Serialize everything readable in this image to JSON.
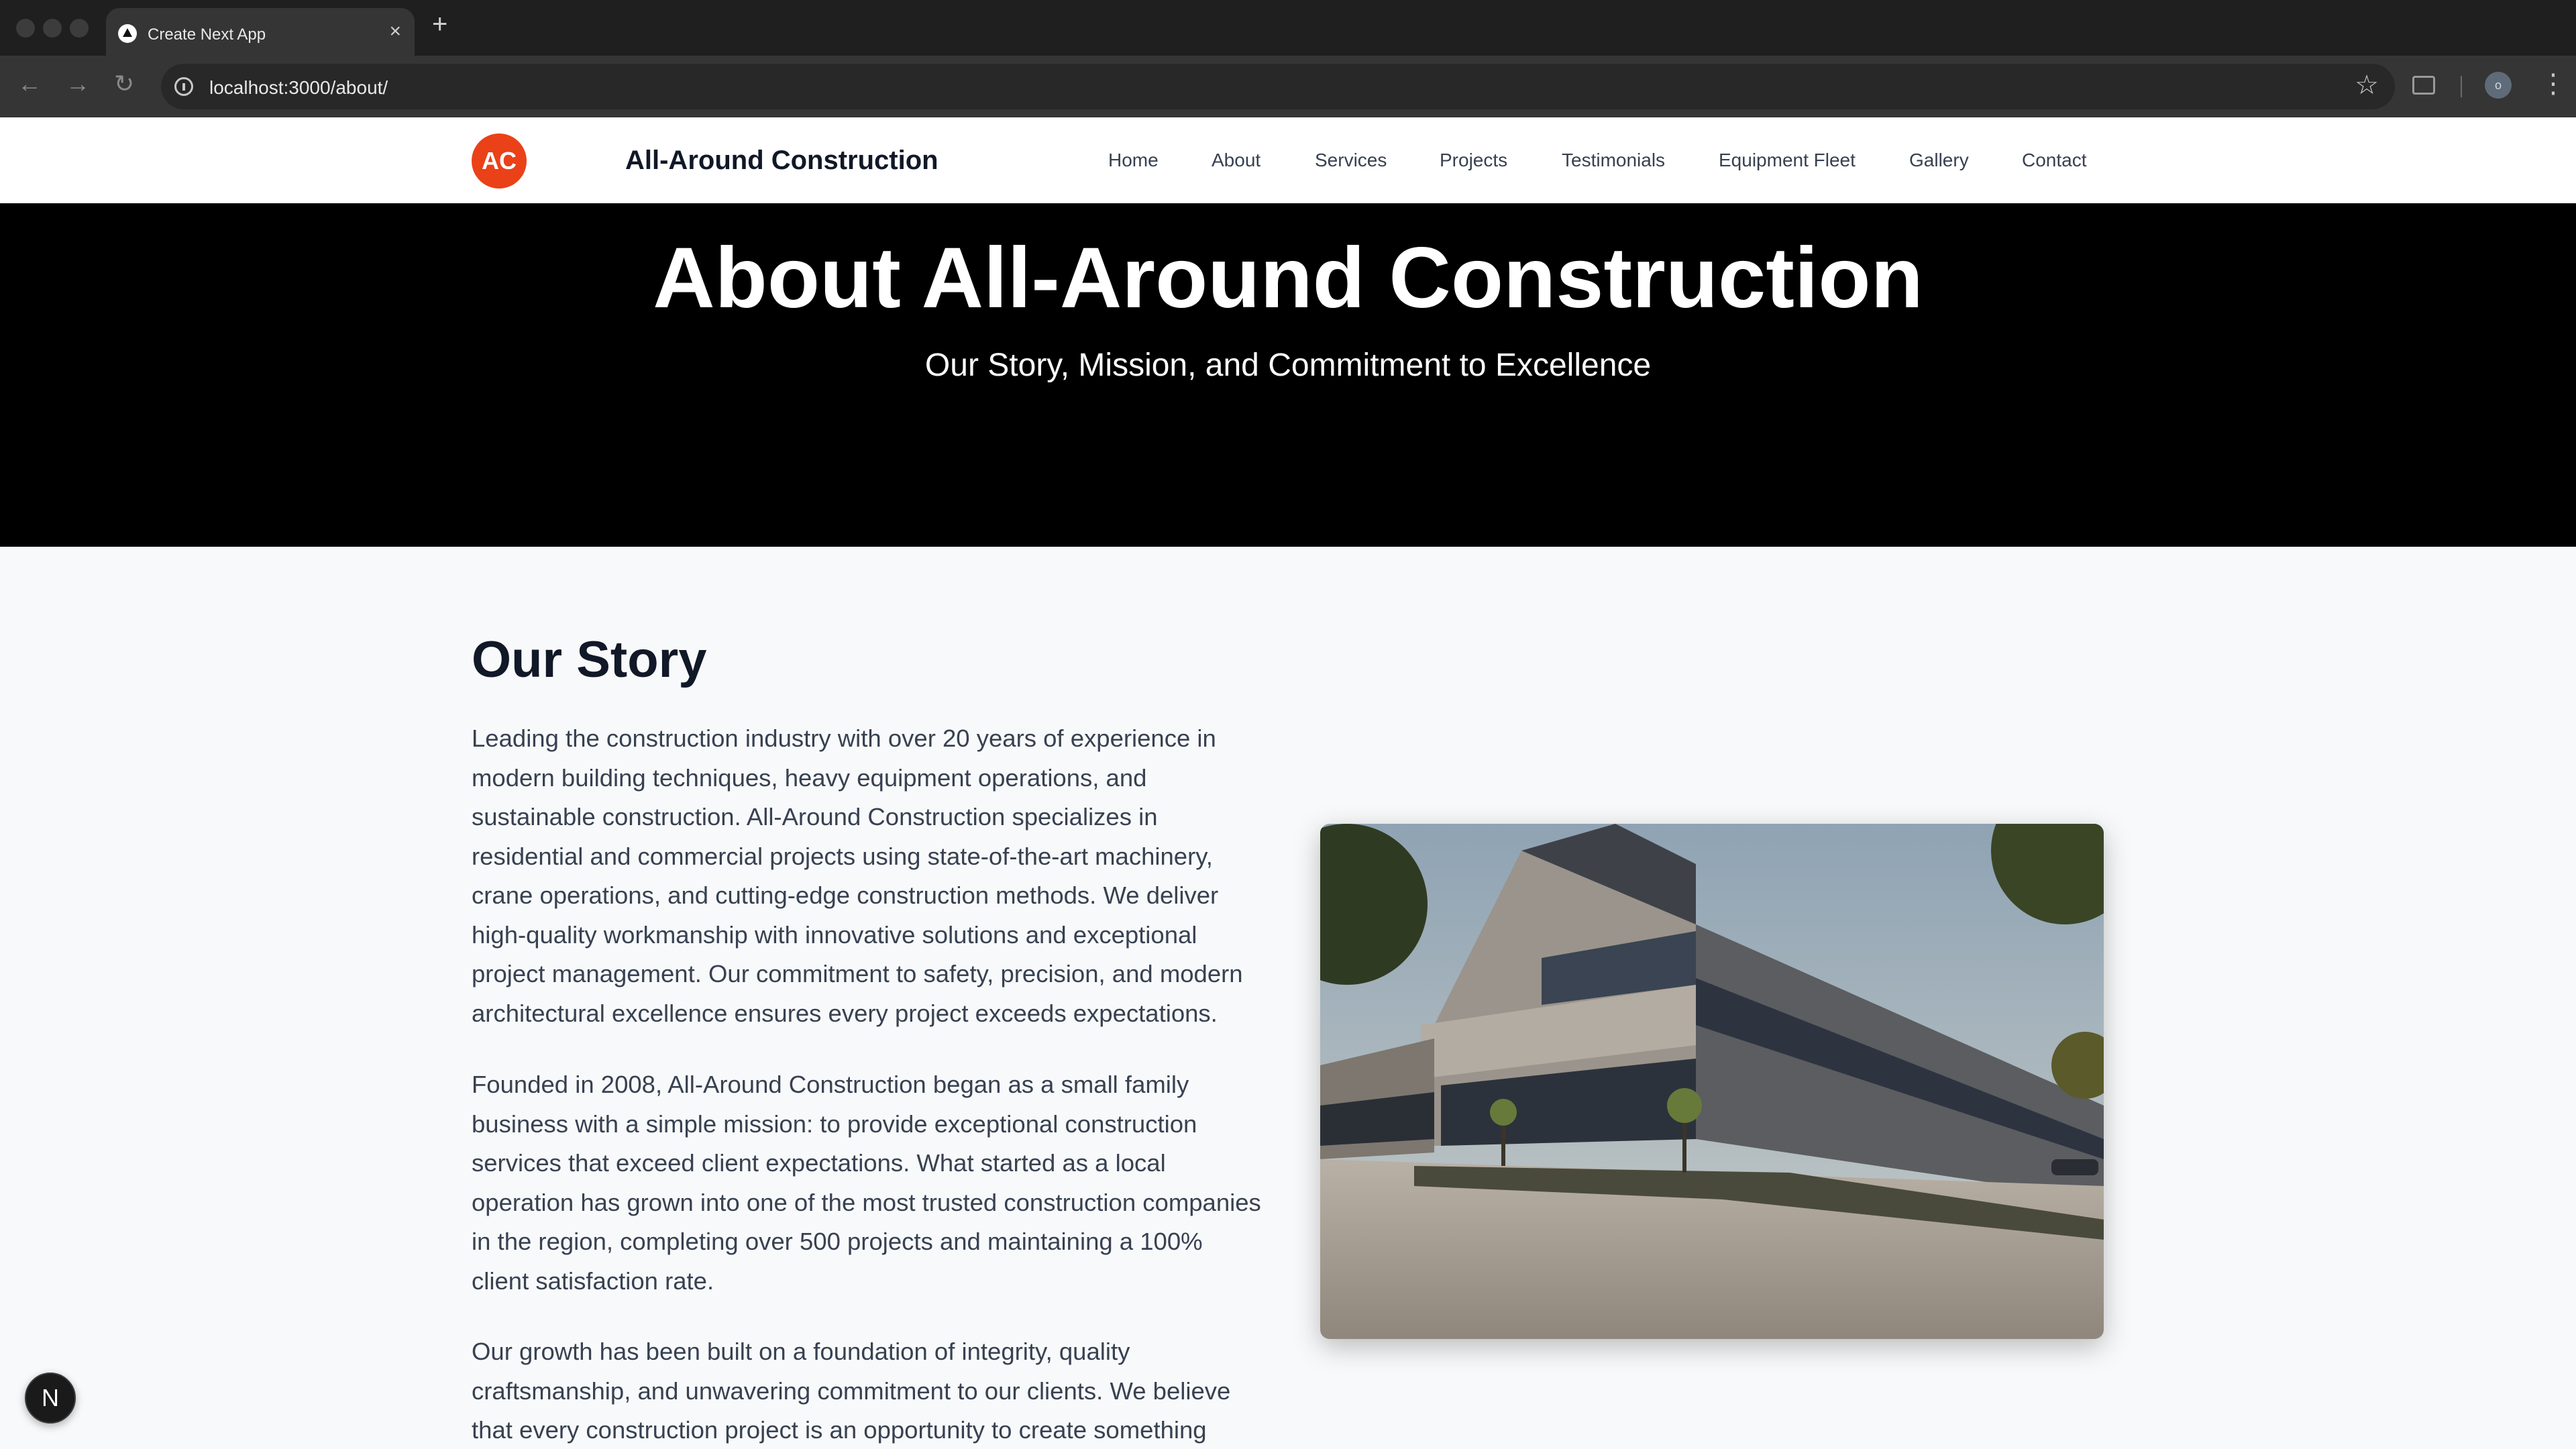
{
  "browser": {
    "tab_title": "Create Next App",
    "new_tab": "+",
    "close": "×",
    "url": "localhost:3000/about/",
    "profile_initial": "o"
  },
  "header": {
    "logo_text": "AC",
    "brand": "All-Around Construction",
    "nav": [
      "Home",
      "About",
      "Services",
      "Projects",
      "Testimonials",
      "Equipment Fleet",
      "Gallery",
      "Contact"
    ]
  },
  "hero": {
    "title": "About All-Around Construction",
    "subtitle": "Our Story, Mission, and Commitment to Excellence"
  },
  "story": {
    "heading": "Our Story",
    "paragraphs": [
      "Leading the construction industry with over 20 years of experience in modern building techniques, heavy equipment operations, and sustainable construction. All-Around Construction specializes in residential and commercial projects using state-of-the-art machinery, crane operations, and cutting-edge construction methods. We deliver high-quality workmanship with innovative solutions and exceptional project management. Our commitment to safety, precision, and modern architectural excellence ensures every project exceeds expectations.",
      "Founded in 2008, All-Around Construction began as a small family business with a simple mission: to provide exceptional construction services that exceed client expectations. What started as a local operation has grown into one of the most trusted construction companies in the region, completing over 500 projects and maintaining a 100% client satisfaction rate.",
      "Our growth has been built on a foundation of integrity, quality craftsmanship, and unwavering commitment to our clients. We believe that every construction project is an opportunity to create something"
    ]
  },
  "dev_indicator": "N",
  "colors": {
    "accent": "#ea4118",
    "hero_bg": "#000000",
    "page_bg": "#f8f9fa"
  }
}
